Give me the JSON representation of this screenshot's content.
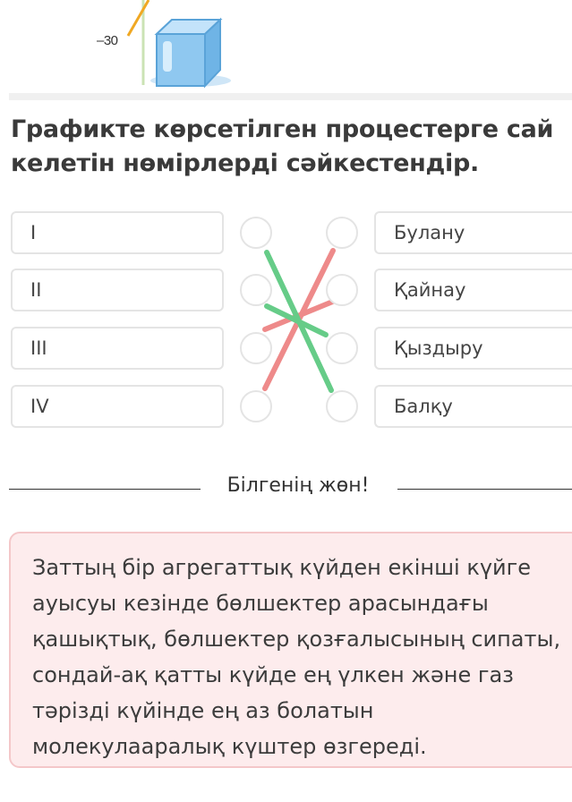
{
  "graph": {
    "axis_tick_label": "–30"
  },
  "question": {
    "text": "Графикте көрсетілген процестерге сай келетін нөмірлерді сәйкестендір."
  },
  "items": [
    "I",
    "II",
    "III",
    "IV"
  ],
  "answers": [
    "Булану",
    "Қайнау",
    "Қыздыру",
    "Балқу"
  ],
  "connections": [
    {
      "from": "I",
      "to": "Балқу",
      "color": "#66cc88"
    },
    {
      "from": "II",
      "to": "Қыздыру",
      "color": "#66cc88"
    },
    {
      "from": "III",
      "to": "Қайнау",
      "color": "#ee8a8a"
    },
    {
      "from": "IV",
      "to": "Булану",
      "color": "#ee8a8a"
    }
  ],
  "info": {
    "heading": "Білгенің жөн!",
    "text": "Заттың бір агрегаттық күйден екінші күйге ауысуы кезінде бөлшектер арасындағы қашықтық, бөлшектер қозғалысының сипаты, сондай-ақ қатты күйде ең үлкен және газ тәрізді күйінде ең аз болатын молекулааралық күштер өзгереді."
  },
  "colors": {
    "correct": "#66cc88",
    "incorrect": "#ee8a8a",
    "info_bg": "#fdeced",
    "info_border": "#f4c7c9"
  }
}
